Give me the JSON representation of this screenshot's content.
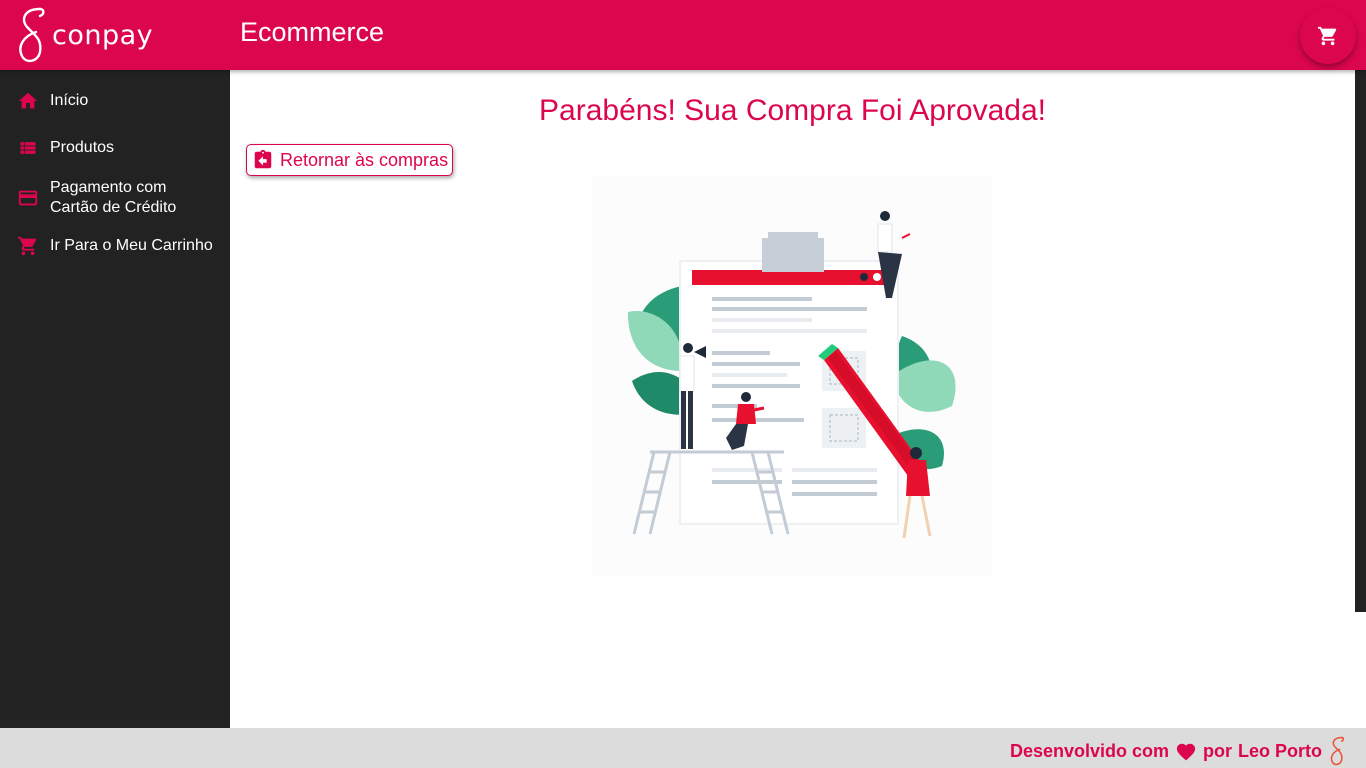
{
  "header": {
    "logo_text": "conpay",
    "title": "Ecommerce",
    "cart_icon": "cart-icon"
  },
  "sidebar": {
    "items": [
      {
        "label": "Início",
        "icon": "home-icon"
      },
      {
        "label": "Produtos",
        "icon": "list-icon"
      },
      {
        "label": "Pagamento com\nCartão de Crédito",
        "icon": "credit-card-icon"
      },
      {
        "label": "Ir Para o Meu Carrinho",
        "icon": "cart-icon"
      }
    ]
  },
  "main": {
    "title": "Parabéns! Sua Compra Foi Aprovada!",
    "return_button": {
      "label": "Retornar às compras",
      "icon": "assignment-return-icon"
    },
    "illustration": "approved-purchase-illustration"
  },
  "footer": {
    "prefix": "Desenvolvido com",
    "middle": "por",
    "author": "Leo Porto",
    "heart_icon": "heart-icon",
    "logo_icon": "conpay-logo-icon"
  },
  "colors": {
    "primary": "#dc064e",
    "sidebar": "#222222",
    "footer": "#dcdcdc",
    "green": "#2a9d78",
    "red": "#e8102f"
  }
}
